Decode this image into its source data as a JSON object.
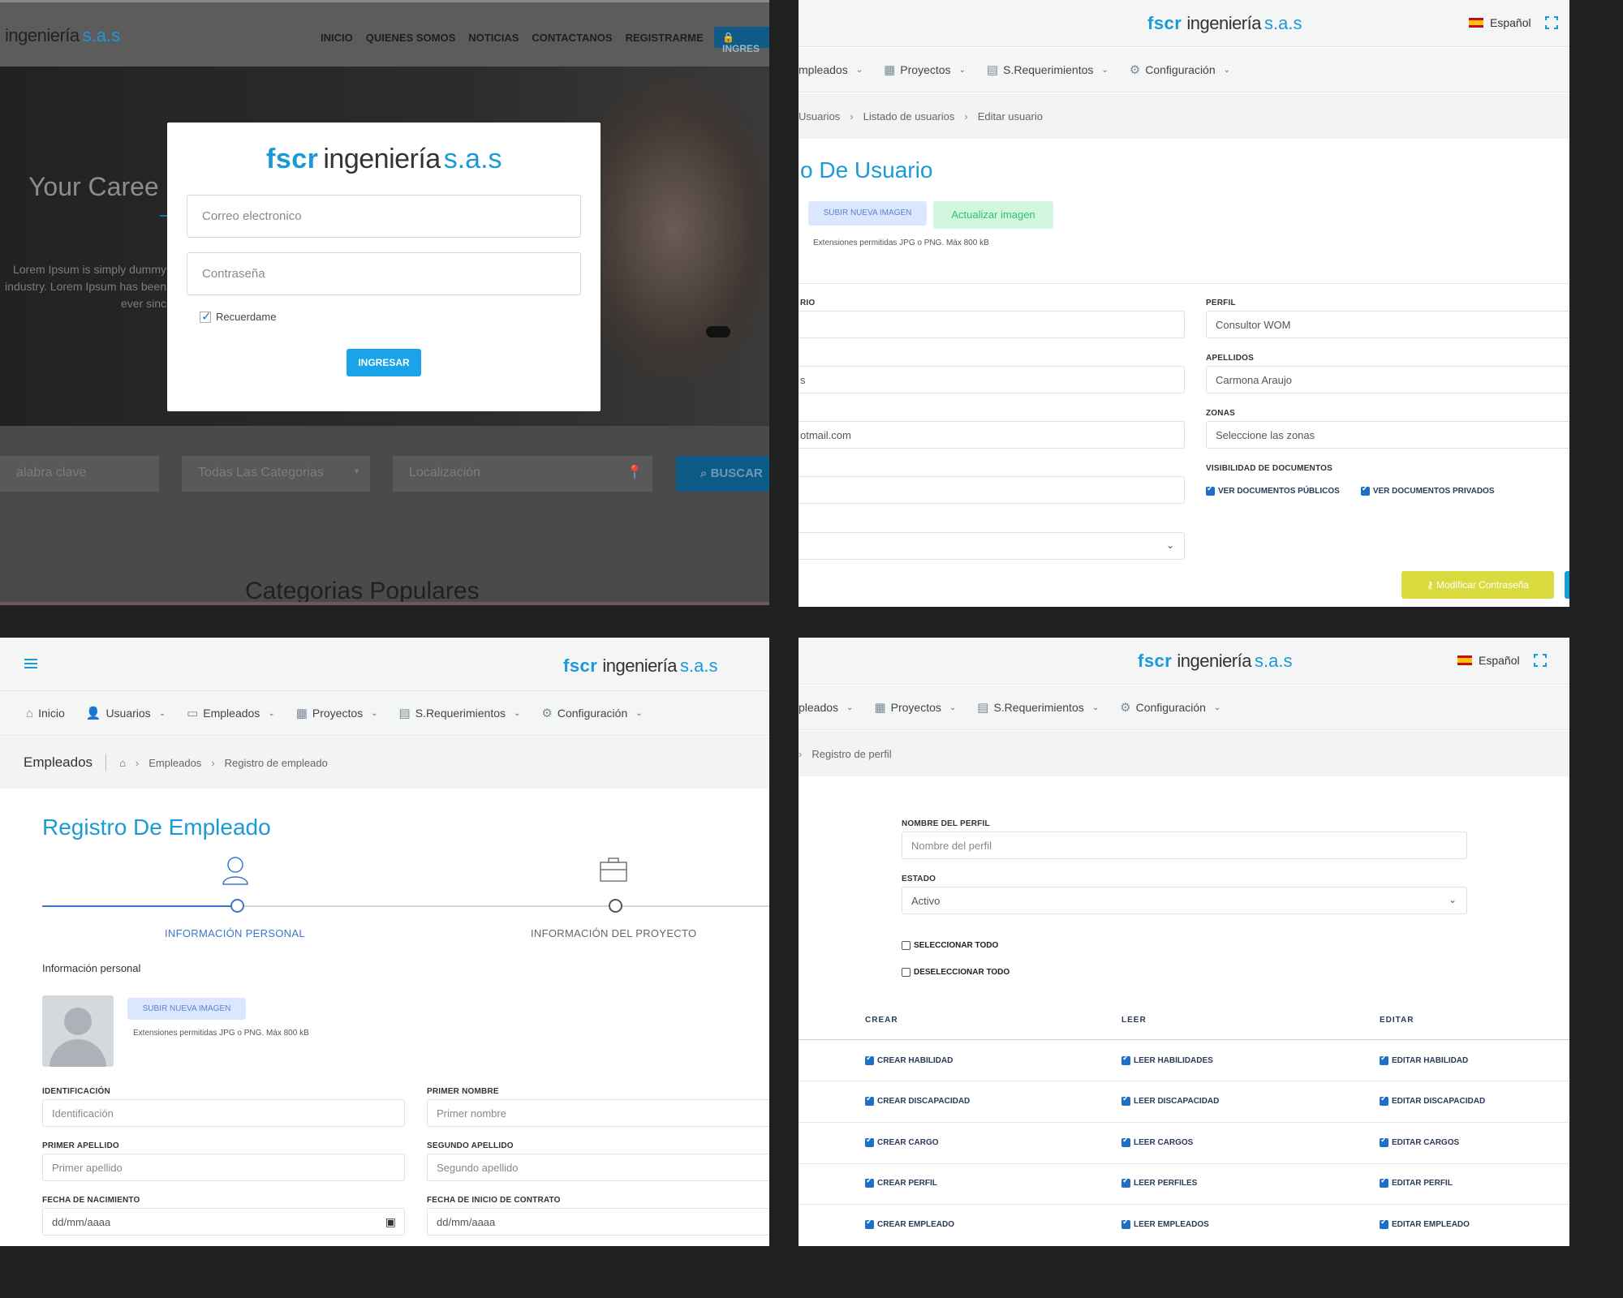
{
  "logo": {
    "part_a": "fscr",
    "part_b": "ingeniería",
    "part_c": "s.a.s"
  },
  "panel_login": {
    "nav": [
      "INICIO",
      "QUIENES SOMOS",
      "NOTICIAS",
      "CONTACTANOS",
      "REGISTRARME"
    ],
    "login_button": "INGRES",
    "hero_title": "Your Caree",
    "hero_text": "Lorem Ipsum is simply dummy industry. Lorem Ipsum has been ever sinc",
    "search": {
      "keyword": "alabra clave",
      "category": "Todas Las Categorias",
      "location": "Localización",
      "button": "BUSCAR"
    },
    "section_title": "Categorias Populares",
    "modal": {
      "email_placeholder": "Correo electronico",
      "password_placeholder": "Contraseña",
      "remember": "Recuerdame",
      "submit": "INGRESAR"
    }
  },
  "panel_user": {
    "lang": "Español",
    "nav": [
      "mpleados",
      "Proyectos",
      "S.Requerimientos",
      "Configuración"
    ],
    "breadcrumb": [
      "Usuarios",
      "Listado de usuarios",
      "Editar usuario"
    ],
    "title": "o De Usuario",
    "upload_button": "SUBIR NUEVA IMAGEN",
    "update_button": "Actualizar imagen",
    "extensions": "Extensiones permitidas JPG o PNG. Máx 800 kB",
    "left_label": "RIO",
    "left_values": [
      "",
      "s",
      "otmail.com",
      "",
      ""
    ],
    "perfil_label": "PERFIL",
    "perfil_value": "Consultor WOM",
    "apellidos_label": "APELLIDOS",
    "apellidos_value": "Carmona Araujo",
    "zonas_label": "ZONAS",
    "zonas_placeholder": "Seleccione  las zonas",
    "visibility_label": "VISIBILIDAD DE DOCUMENTOS",
    "vis_public": "VER DOCUMENTOS PÚBLICOS",
    "vis_private": "VER DOCUMENTOS PRIVADOS",
    "password_button": "Modificar Contraseña"
  },
  "panel_employee": {
    "nav": [
      "Inicio",
      "Usuarios",
      "Empleados",
      "Proyectos",
      "S.Requerimientos",
      "Configuración"
    ],
    "crumb_title": "Empleados",
    "breadcrumb": [
      "Empleados",
      "Registro de empleado"
    ],
    "title": "Registro De Empleado",
    "step1": "INFORMACIÓN PERSONAL",
    "step2": "INFORMACIÓN DEL PROYECTO",
    "section": "Información personal",
    "upload_button": "SUBIR NUEVA IMAGEN",
    "extensions": "Extensiones permitidas JPG o PNG. Máx 800 kB",
    "fields": [
      {
        "label": "IDENTIFICACIÓN",
        "placeholder": "Identificación"
      },
      {
        "label": "PRIMER NOMBRE",
        "placeholder": "Primer nombre"
      },
      {
        "label": "PRIMER APELLIDO",
        "placeholder": "Primer apellido"
      },
      {
        "label": "SEGUNDO APELLIDO",
        "placeholder": "Segundo apellido"
      },
      {
        "label": "FECHA DE NACIMIENTO",
        "placeholder": "dd/mm/aaaa"
      },
      {
        "label": "FECHA DE INICIO DE CONTRATO",
        "placeholder": "dd/mm/aaaa"
      }
    ]
  },
  "panel_profile": {
    "lang": "Español",
    "nav": [
      "pleados",
      "Proyectos",
      "S.Requerimientos",
      "Configuración"
    ],
    "breadcrumb": "Registro de perfil",
    "name_label": "NOMBRE DEL PERFIL",
    "name_placeholder": "Nombre del perfil",
    "state_label": "ESTADO",
    "state_value": "Activo",
    "select_all": "SELECCIONAR TODO",
    "deselect_all": "DESELECCIONAR TODO",
    "columns": [
      "CREAR",
      "LEER",
      "EDITAR"
    ],
    "rows": [
      [
        "CREAR HABILIDAD",
        "LEER HABILIDADES",
        "EDITAR HABILIDAD"
      ],
      [
        "CREAR DISCAPACIDAD",
        "LEER DISCAPACIDAD",
        "EDITAR DISCAPACIDAD"
      ],
      [
        "CREAR CARGO",
        "LEER CARGOS",
        "EDITAR CARGOS"
      ],
      [
        "CREAR PERFIL",
        "LEER PERFILES",
        "EDITAR PERFIL"
      ],
      [
        "CREAR EMPLEADO",
        "LEER EMPLEADOS",
        "EDITAR EMPLEADO"
      ]
    ]
  }
}
